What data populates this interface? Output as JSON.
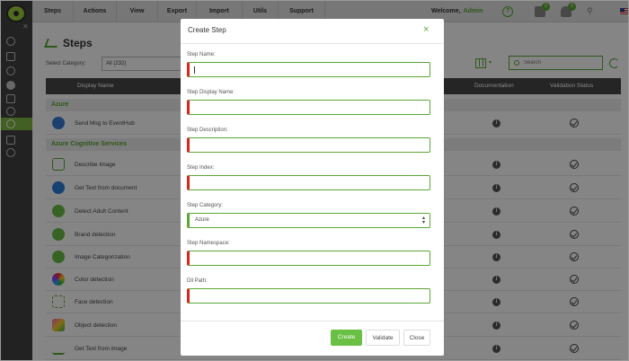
{
  "topnav": {
    "items": [
      "Steps",
      "Actions",
      "View",
      "Export",
      "Import",
      "Utils",
      "Support"
    ],
    "welcome_label": "Welcome,",
    "user": "Admin",
    "help_glyph": "?",
    "package_badge": "0",
    "bell_badge": "0"
  },
  "page": {
    "title": "Steps",
    "category_label": "Select Category:",
    "category_value": "All (232)",
    "search_placeholder": "Search"
  },
  "table": {
    "headers": {
      "display_name": "Display Name",
      "documentation": "Documentation",
      "validation_status": "Validation Status"
    },
    "groups": [
      {
        "label": "Azure",
        "rows": [
          {
            "name": "Send Msg to EventHub",
            "icon": "eventhub-icon"
          }
        ]
      },
      {
        "label": "Azure Cognitive Services",
        "rows": [
          {
            "name": "Describe Image",
            "icon": "describe-image-icon"
          },
          {
            "name": "Get Text from document",
            "icon": "get-text-document-icon"
          },
          {
            "name": "Detect Adult Content",
            "icon": "adult-content-icon"
          },
          {
            "name": "Brand detection",
            "icon": "brand-detection-icon"
          },
          {
            "name": "Image Categorization",
            "icon": "image-categorization-icon"
          },
          {
            "name": "Color detection",
            "icon": "color-detection-icon"
          },
          {
            "name": "Face detection",
            "icon": "face-detection-icon"
          },
          {
            "name": "Object detection",
            "icon": "object-detection-icon"
          },
          {
            "name": "Get Text from image",
            "icon": "ocr-icon"
          }
        ]
      }
    ],
    "info_glyph": "i"
  },
  "modal": {
    "title": "Create Step",
    "close_glyph": "×",
    "fields": {
      "step_name": {
        "label": "Step Name:",
        "value": ""
      },
      "display_name": {
        "label": "Step Display Name:",
        "value": ""
      },
      "description": {
        "label": "Step Description:",
        "value": ""
      },
      "index": {
        "label": "Step Index:",
        "value": ""
      },
      "category": {
        "label": "Step Category:",
        "value": "Azure"
      },
      "namespace": {
        "label": "Step Namespace:",
        "value": ""
      },
      "dll_path": {
        "label": "Dll Path:",
        "value": ""
      }
    },
    "buttons": {
      "create": "Create",
      "validate": "Validate",
      "close": "Close"
    }
  },
  "colors": {
    "accent": "#5ba735",
    "required": "#d9261c",
    "sidebar": "#424242",
    "header": "#484848"
  }
}
